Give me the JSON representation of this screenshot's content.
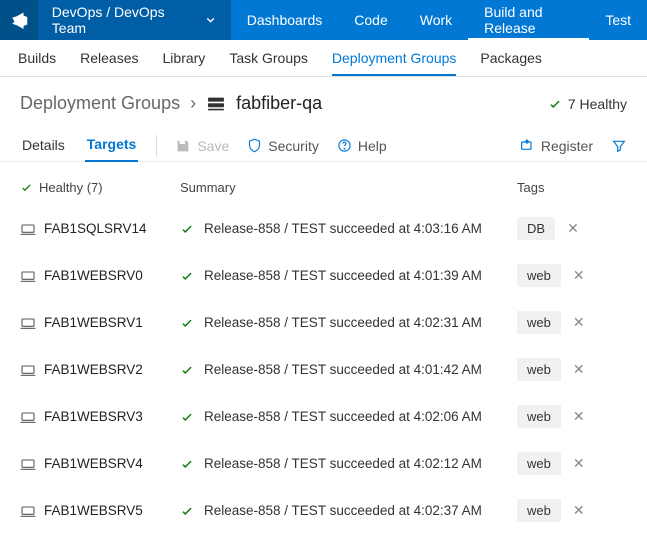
{
  "topnav": {
    "team": "DevOps / DevOps Team",
    "items": [
      {
        "label": "Dashboards",
        "active": false
      },
      {
        "label": "Code",
        "active": false
      },
      {
        "label": "Work",
        "active": false
      },
      {
        "label": "Build and Release",
        "active": true
      },
      {
        "label": "Test",
        "active": false
      }
    ]
  },
  "subnav": {
    "items": [
      {
        "label": "Builds",
        "active": false
      },
      {
        "label": "Releases",
        "active": false
      },
      {
        "label": "Library",
        "active": false
      },
      {
        "label": "Task Groups",
        "active": false
      },
      {
        "label": "Deployment Groups",
        "active": true
      },
      {
        "label": "Packages",
        "active": false
      }
    ]
  },
  "breadcrumb": {
    "root": "Deployment Groups",
    "name": "fabfiber-qa"
  },
  "health_top": "7 Healthy",
  "tabs": {
    "items": [
      {
        "label": "Details",
        "active": false
      },
      {
        "label": "Targets",
        "active": true
      }
    ],
    "save": "Save",
    "security": "Security",
    "help": "Help",
    "register": "Register"
  },
  "columns": {
    "healthy": "Healthy (7)",
    "summary": "Summary",
    "tags": "Tags"
  },
  "targets": [
    {
      "name": "FAB1SQLSRV14",
      "summary": "Release-858 / TEST succeeded at 4:03:16 AM",
      "tag": "DB"
    },
    {
      "name": "FAB1WEBSRV0",
      "summary": "Release-858 / TEST succeeded at 4:01:39 AM",
      "tag": "web"
    },
    {
      "name": "FAB1WEBSRV1",
      "summary": "Release-858 / TEST succeeded at 4:02:31 AM",
      "tag": "web"
    },
    {
      "name": "FAB1WEBSRV2",
      "summary": "Release-858 / TEST succeeded at 4:01:42 AM",
      "tag": "web"
    },
    {
      "name": "FAB1WEBSRV3",
      "summary": "Release-858 / TEST succeeded at 4:02:06 AM",
      "tag": "web"
    },
    {
      "name": "FAB1WEBSRV4",
      "summary": "Release-858 / TEST succeeded at 4:02:12 AM",
      "tag": "web"
    },
    {
      "name": "FAB1WEBSRV5",
      "summary": "Release-858 / TEST succeeded at 4:02:37 AM",
      "tag": "web"
    }
  ],
  "colors": {
    "accent": "#0078d4",
    "success": "#107c10"
  }
}
